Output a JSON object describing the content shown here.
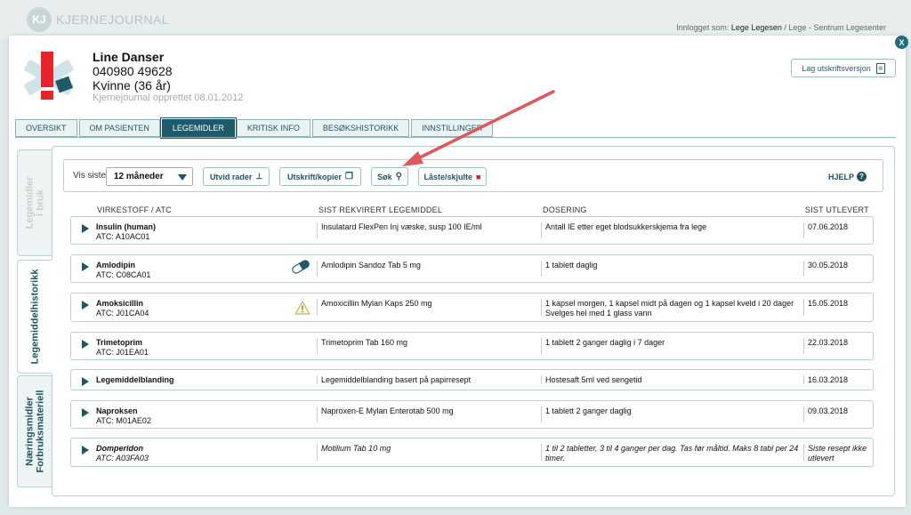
{
  "app": {
    "logo_mark": "KJ",
    "logo_text": "KJERNEJOURNAL"
  },
  "login": {
    "prefix": "Innlogget som:",
    "user": "Lege Legesen",
    "suffix": "/ Lege - Sentrum Legesenter"
  },
  "close_label": "X",
  "patient": {
    "name": "Line Danser",
    "id": "040980 49628",
    "gender_age": "Kvinne (36 år)",
    "created": "Kjernejournal opprettet 08.01.2012"
  },
  "print_button": {
    "label": "Lag utskriftsversjon",
    "icon": "pdf-icon"
  },
  "tabs": [
    "OVERSIKT",
    "OM PASIENTEN",
    "LEGEMIDLER",
    "KRITISK INFO",
    "BESØKSHISTORIKK",
    "INNSTILLINGER"
  ],
  "active_tab": "LEGEMIDLER",
  "side_tabs": {
    "in_use": "Legemidler i bruk",
    "history": "Legemiddelhistorikk",
    "nutrition_line1": "Næringsmidler",
    "nutrition_line2": "Forbruksmateriell"
  },
  "toolbar": {
    "vis_label": "Vis siste",
    "period": "12 måneder",
    "expand": "Utvid rader",
    "print_copy": "Utskrift/kopier",
    "search": "Søk",
    "locked": "Låste/skjulte",
    "help": "HJELP"
  },
  "columns": {
    "substance": "VIRKESTOFF / ATC",
    "drug": "SIST REKVIRERT LEGEMIDDEL",
    "dosage": "DOSERING",
    "dispensed": "SIST UTLEVERT"
  },
  "rows": [
    {
      "name": "Insulin (human)",
      "atc": "ATC: A10AC01",
      "drug": "Insulatard FlexPen Inj væske, susp 100 IE/ml",
      "dose": "Antall IE etter eget blodsukkerskjema fra lege",
      "date": "07.06.2018"
    },
    {
      "name": "Amlodipin",
      "atc": "ATC: C08CA01",
      "drug": "Amlodipin Sandoz Tab 5 mg",
      "dose": "1 tablett daglig",
      "date": "30.05.2018",
      "icon": "pill-icon"
    },
    {
      "name": "Amoksicillin",
      "atc": "ATC: J01CA04",
      "drug": "Amoxicillin Mylan Kaps 250 mg",
      "dose": "1 kapsel morgen, 1 kapsel midt på dagen og 1 kapsel kveld i 20 dager Svelges hel med 1 glass vann",
      "date": "15.05.2018",
      "icon": "warning-icon"
    },
    {
      "name": "Trimetoprim",
      "atc": "ATC: J01EA01",
      "drug": "Trimetoprim Tab 160 mg",
      "dose": "1 tablett 2 ganger daglig i 7 dager",
      "date": "22.03.2018"
    },
    {
      "name": "Legemiddelblanding",
      "atc": "",
      "drug": "Legemiddelblanding basert på papirresept",
      "dose": "Hostesaft 5ml ved sengetid",
      "date": "16.03.2018"
    },
    {
      "name": "Naproksen",
      "atc": "ATC: M01AE02",
      "drug": "Naproxen-E Mylan Enterotab 500 mg",
      "dose": "1 tablett 2 ganger daglig",
      "date": "09.03.2018"
    },
    {
      "name": "Domperidon",
      "atc": "ATC: A03FA03",
      "drug": "Motilium Tab 10 mg",
      "dose": "1 til 2 tabletter, 3 til 4 ganger per dag. Tas før måltid. Maks 8 tabl per 24 timer.",
      "date": "Siste resept ikke utlevert",
      "italic": true
    }
  ],
  "colors": {
    "primary": "#1d5b6a",
    "border": "#b8d2d6",
    "annotation": "#e0575b",
    "logo_red": "#e8232a"
  }
}
